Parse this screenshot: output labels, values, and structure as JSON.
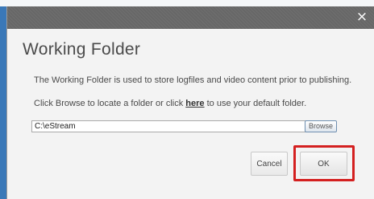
{
  "window": {
    "close_glyph": "×"
  },
  "dialog": {
    "title": "Working Folder",
    "description": "The Working Folder is used to store logfiles and video content prior to publishing.",
    "instruction_before_link": "Click Browse to locate a folder or click ",
    "link_text": "here",
    "instruction_after_link": " to use your default folder."
  },
  "folder_input": {
    "value": "C:\\eStream"
  },
  "buttons": {
    "browse": "Browse",
    "cancel": "Cancel",
    "ok": "OK"
  },
  "colors": {
    "titlebar": "#676767",
    "highlight": "#d42020",
    "left_accent": "#3a78b8"
  },
  "icons": {
    "close": "close-icon"
  }
}
